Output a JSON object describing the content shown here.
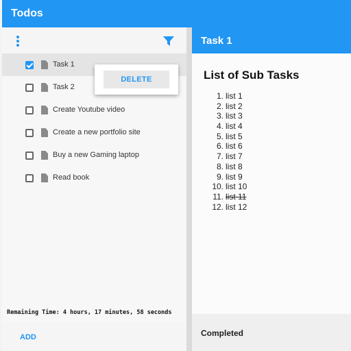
{
  "app": {
    "title": "Todos"
  },
  "toolbar": {
    "menu_icon": "kebab-menu-icon",
    "filter_icon": "filter-icon"
  },
  "todos": [
    {
      "label": "Task 1",
      "checked": true,
      "selected": true
    },
    {
      "label": "Task 2",
      "checked": false,
      "selected": false
    },
    {
      "label": "Create Youtube video",
      "checked": false,
      "selected": false
    },
    {
      "label": "Create a new portfolio site",
      "checked": false,
      "selected": false
    },
    {
      "label": "Buy a new Gaming laptop",
      "checked": false,
      "selected": false
    },
    {
      "label": "Read book",
      "checked": false,
      "selected": false
    }
  ],
  "context_menu": {
    "delete_label": "DELETE"
  },
  "status": {
    "remaining_time": "Remaining Time:  4 hours, 17 minutes, 58 seconds"
  },
  "footer": {
    "add_label": "ADD"
  },
  "detail": {
    "title": "Task 1",
    "subtasks_heading": "List of Sub Tasks",
    "subtasks": [
      {
        "num": "1.",
        "text": "list 1",
        "done": false
      },
      {
        "num": "2.",
        "text": "list 2",
        "done": false
      },
      {
        "num": "3.",
        "text": "list 3",
        "done": false
      },
      {
        "num": "4.",
        "text": "list 4",
        "done": false
      },
      {
        "num": "5.",
        "text": "list 5",
        "done": false
      },
      {
        "num": "6.",
        "text": "list 6",
        "done": false
      },
      {
        "num": "7.",
        "text": "list 7",
        "done": false
      },
      {
        "num": "8.",
        "text": "list 8",
        "done": false
      },
      {
        "num": "9.",
        "text": "list 9",
        "done": false
      },
      {
        "num": "10.",
        "text": "list 10",
        "done": false
      },
      {
        "num": "11.",
        "text": "list 11",
        "done": true
      },
      {
        "num": "12.",
        "text": "list 12",
        "done": false
      }
    ],
    "footer_label": "Completed"
  },
  "colors": {
    "accent": "#2196f3",
    "background": "#f3f3f3"
  }
}
